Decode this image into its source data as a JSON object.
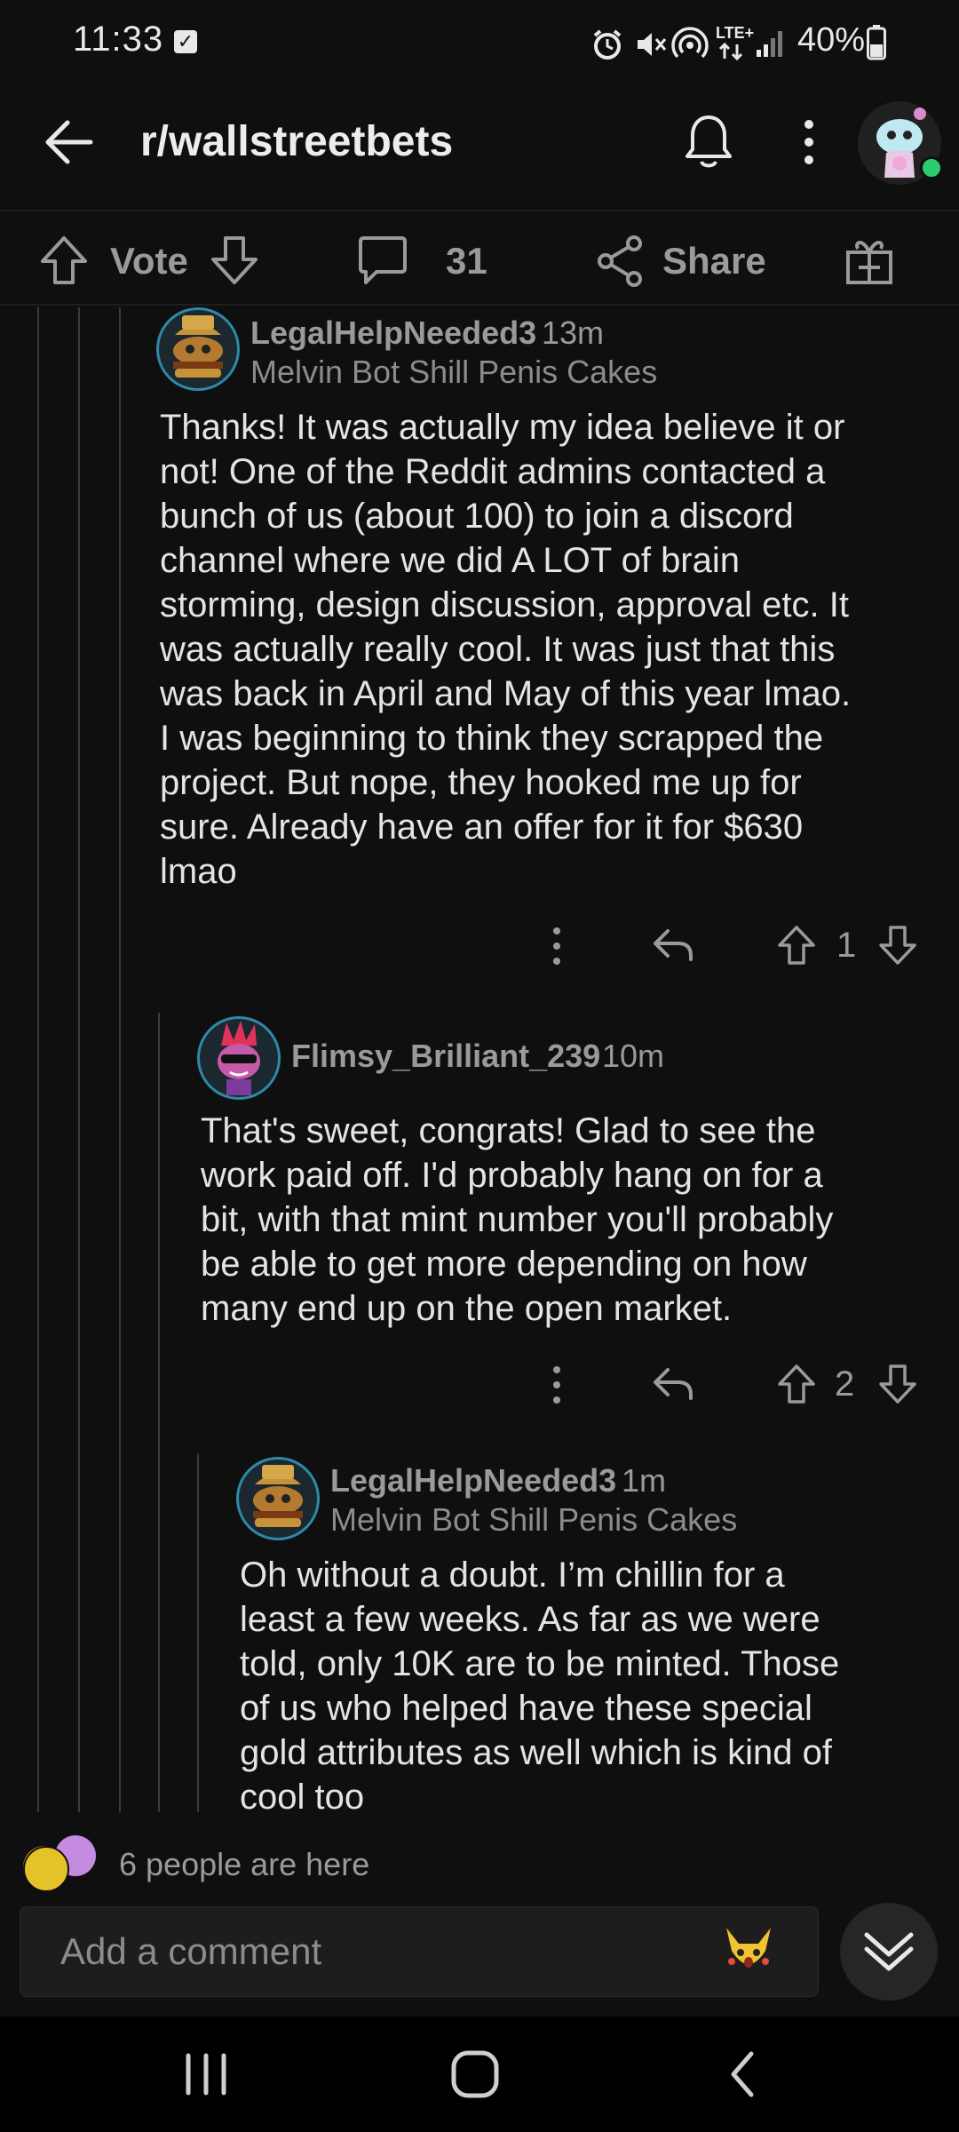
{
  "status_bar": {
    "time": "11:33",
    "battery": "40%",
    "network": "LTE+"
  },
  "header": {
    "title": "r/wallstreetbets"
  },
  "post_bar": {
    "vote_label": "Vote",
    "comment_count": "31",
    "share_label": "Share"
  },
  "comments": [
    {
      "username": "LegalHelpNeeded3",
      "time": "13m",
      "flair": "Melvin Bot Shill Penis Cakes",
      "body_lines": [
        "Thanks! It was actually my idea believe it or",
        "not! One of the Reddit admins contacted a",
        "bunch of us (about 100) to join a discord",
        "channel where we did A LOT of brain",
        "storming, design discussion, approval etc. It",
        "was actually really cool. It was just that this",
        "was back in April and May of this year lmao.",
        "I was beginning to think they scrapped the",
        "project. But nope, they hooked me up for",
        "sure. Already have an offer for it for $630",
        "lmao"
      ],
      "votes": "1"
    },
    {
      "username": "Flimsy_Brilliant_239",
      "time": "10m",
      "body_lines": [
        "That's sweet, congrats! Glad to see the",
        "work paid off. I'd probably hang on for a",
        "bit, with that mint number you'll probably",
        "be able to get more depending on how",
        "many end up on the open market."
      ],
      "votes": "2"
    },
    {
      "username": "LegalHelpNeeded3",
      "time": "1m",
      "flair": "Melvin Bot Shill Penis Cakes",
      "body_lines": [
        "Oh without a doubt. I’m chillin for a",
        "least a few weeks. As far as we were",
        "told, only 10K are to be minted. Those",
        "of us who helped have these special",
        "gold attributes as well which is kind of",
        "cool too"
      ]
    }
  ],
  "presence": "6 people are here",
  "comment_input": {
    "placeholder": "Add a comment"
  },
  "colors": {
    "background": "#0f0f0f",
    "online_dot": "#2ecc71",
    "avatar_border": "#2e89a8"
  }
}
